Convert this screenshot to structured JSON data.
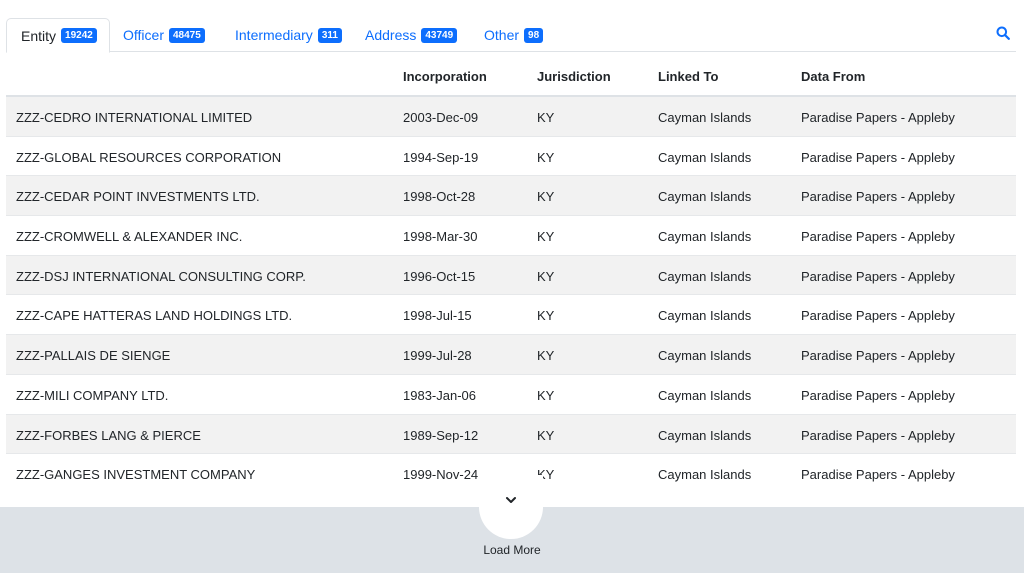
{
  "tabs": [
    {
      "label": "Entity",
      "count": "19242",
      "active": true
    },
    {
      "label": "Officer",
      "count": "48475",
      "active": false
    },
    {
      "label": "Intermediary",
      "count": "311",
      "active": false
    },
    {
      "label": "Address",
      "count": "43749",
      "active": false
    },
    {
      "label": "Other",
      "count": "98",
      "active": false
    }
  ],
  "table": {
    "headers": [
      "",
      "Incorporation",
      "Jurisdiction",
      "Linked To",
      "Data From"
    ],
    "rows": [
      {
        "name": "ZZZ-CEDRO INTERNATIONAL LIMITED",
        "incorporation": "2003-Dec-09",
        "jurisdiction": "KY",
        "linked_to": "Cayman Islands",
        "data_from": "Paradise Papers - Appleby"
      },
      {
        "name": "ZZZ-GLOBAL RESOURCES CORPORATION",
        "incorporation": "1994-Sep-19",
        "jurisdiction": "KY",
        "linked_to": "Cayman Islands",
        "data_from": "Paradise Papers - Appleby"
      },
      {
        "name": "ZZZ-CEDAR POINT INVESTMENTS LTD.",
        "incorporation": "1998-Oct-28",
        "jurisdiction": "KY",
        "linked_to": "Cayman Islands",
        "data_from": "Paradise Papers - Appleby"
      },
      {
        "name": "ZZZ-CROMWELL & ALEXANDER INC.",
        "incorporation": "1998-Mar-30",
        "jurisdiction": "KY",
        "linked_to": "Cayman Islands",
        "data_from": "Paradise Papers - Appleby"
      },
      {
        "name": "ZZZ-DSJ INTERNATIONAL CONSULTING CORP.",
        "incorporation": "1996-Oct-15",
        "jurisdiction": "KY",
        "linked_to": "Cayman Islands",
        "data_from": "Paradise Papers - Appleby"
      },
      {
        "name": "ZZZ-CAPE HATTERAS LAND HOLDINGS LTD.",
        "incorporation": "1998-Jul-15",
        "jurisdiction": "KY",
        "linked_to": "Cayman Islands",
        "data_from": "Paradise Papers - Appleby"
      },
      {
        "name": "ZZZ-PALLAIS DE SIENGE",
        "incorporation": "1999-Jul-28",
        "jurisdiction": "KY",
        "linked_to": "Cayman Islands",
        "data_from": "Paradise Papers - Appleby"
      },
      {
        "name": "ZZZ-MILI COMPANY LTD.",
        "incorporation": "1983-Jan-06",
        "jurisdiction": "KY",
        "linked_to": "Cayman Islands",
        "data_from": "Paradise Papers - Appleby"
      },
      {
        "name": "ZZZ-FORBES LANG & PIERCE",
        "incorporation": "1989-Sep-12",
        "jurisdiction": "KY",
        "linked_to": "Cayman Islands",
        "data_from": "Paradise Papers - Appleby"
      },
      {
        "name": "ZZZ-GANGES INVESTMENT COMPANY",
        "incorporation": "1999-Nov-24",
        "jurisdiction": "KY",
        "linked_to": "Cayman Islands",
        "data_from": "Paradise Papers - Appleby"
      }
    ]
  },
  "load_more": {
    "label": "Load More",
    "icon": "chevron-down-icon"
  },
  "search": {
    "icon": "search-icon"
  },
  "colors": {
    "accent": "#0d6efd",
    "stripe": "#f2f2f2",
    "footer_bg": "#dde2e7"
  }
}
